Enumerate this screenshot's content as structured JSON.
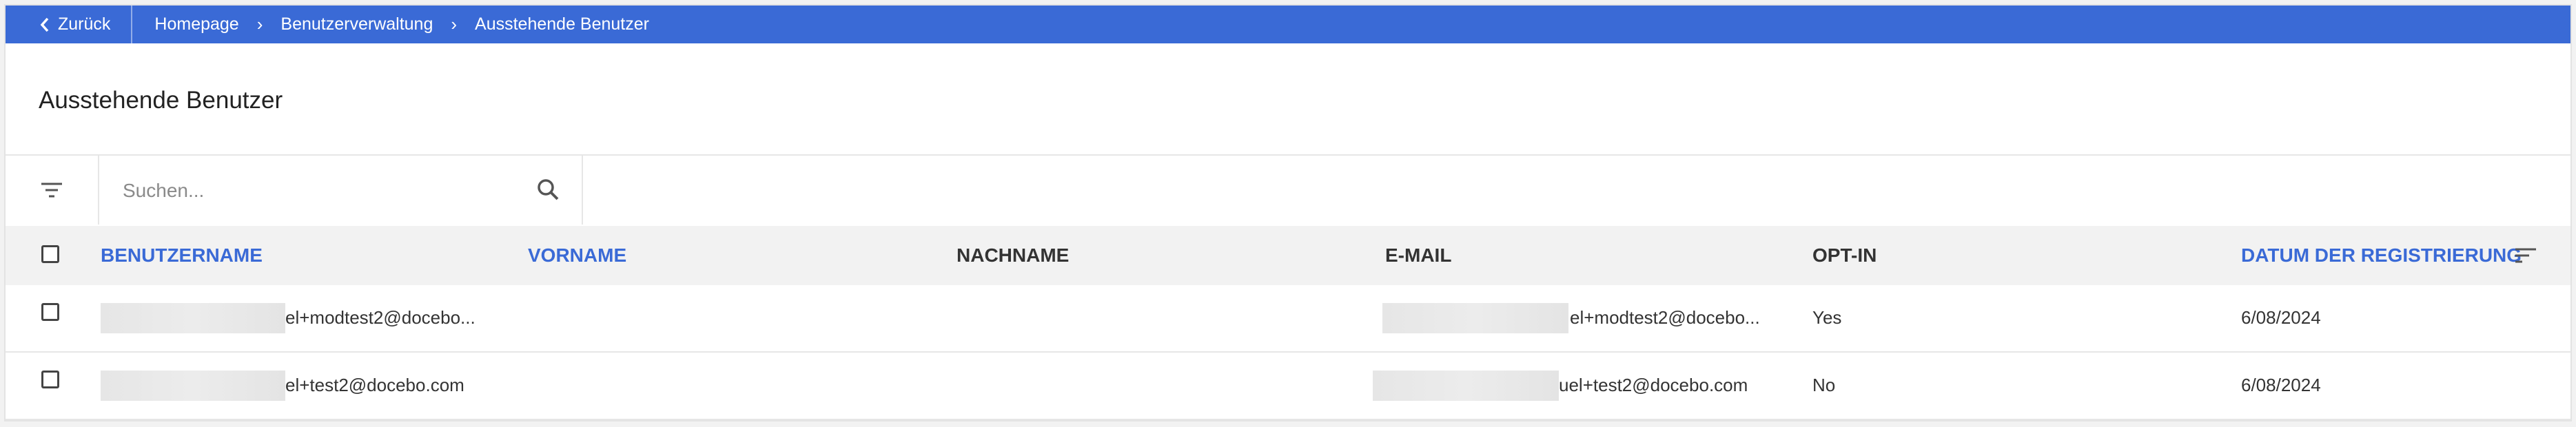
{
  "topbar": {
    "back_label": "Zurück",
    "breadcrumbs": [
      "Homepage",
      "Benutzerverwaltung",
      "Ausstehende Benutzer"
    ]
  },
  "page": {
    "title": "Ausstehende Benutzer"
  },
  "search": {
    "placeholder": "Suchen..."
  },
  "table": {
    "columns": [
      "BENUTZERNAME",
      "VORNAME",
      "NACHNAME",
      "E-MAIL",
      "OPT-IN",
      "DATUM DER REGISTRIERUNG"
    ],
    "rows": [
      {
        "username": "el+modtest2@docebo...",
        "firstname": "",
        "lastname": "",
        "email": "el+modtest2@docebo...",
        "optin": "Yes",
        "date": "6/08/2024"
      },
      {
        "username": "el+test2@docebo.com",
        "firstname": "",
        "lastname": "",
        "email": "uel+test2@docebo.com",
        "optin": "No",
        "date": "6/08/2024"
      }
    ]
  },
  "colors": {
    "accent": "#3a6ad6",
    "header_bg": "#f2f2f2"
  }
}
